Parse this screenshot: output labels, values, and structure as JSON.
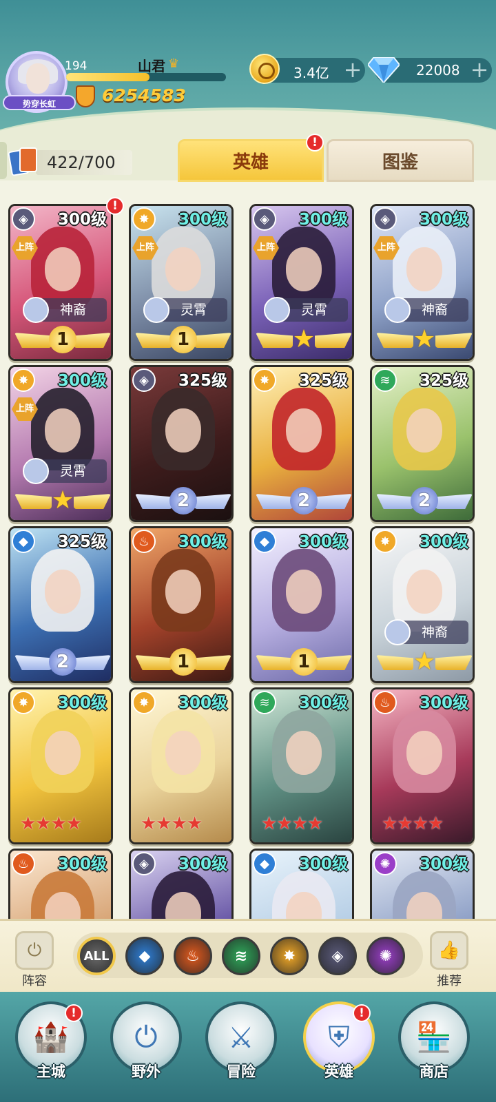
{
  "player": {
    "level": "194",
    "name": "山君",
    "title_badge": "势穿长虹",
    "power": "6254583",
    "xp_progress": 0.52
  },
  "resources": {
    "gold": "3.4亿",
    "diamonds": "22008",
    "plus": "+"
  },
  "collection": {
    "count": "422/700"
  },
  "tabs": {
    "heroes": "英雄",
    "gallery": "图鉴",
    "alert": "!"
  },
  "cards": [
    {
      "level": "300级",
      "level_color": "white",
      "faction": "dark",
      "deployed": "上阵",
      "label": "神裔",
      "rank": "1",
      "wing": "gold",
      "alert": "!"
    },
    {
      "level": "300级",
      "level_color": "cyan",
      "faction": "light",
      "deployed": "上阵",
      "label": "灵霄",
      "rank": "1",
      "wing": "gold"
    },
    {
      "level": "300级",
      "level_color": "cyan",
      "faction": "dark",
      "deployed": "上阵",
      "label": "灵霄",
      "rank": "★",
      "wing": "gold"
    },
    {
      "level": "300级",
      "level_color": "cyan",
      "faction": "dark",
      "deployed": "上阵",
      "label": "神裔",
      "rank": "★",
      "wing": "gold"
    },
    {
      "level": "300级",
      "level_color": "cyan",
      "faction": "light",
      "deployed": "上阵",
      "label": "灵霄",
      "rank": "★",
      "wing": "gold"
    },
    {
      "level": "325级",
      "level_color": "white",
      "faction": "dark",
      "rank": "2",
      "wing": "blue"
    },
    {
      "level": "325级",
      "level_color": "white",
      "faction": "light",
      "rank": "2",
      "wing": "blue"
    },
    {
      "level": "325级",
      "level_color": "white",
      "faction": "nature",
      "rank": "2",
      "wing": "blue"
    },
    {
      "level": "325级",
      "level_color": "white",
      "faction": "water",
      "rank": "2",
      "wing": "blue"
    },
    {
      "level": "300级",
      "level_color": "cyan",
      "faction": "fire",
      "rank": "1",
      "wing": "gold"
    },
    {
      "level": "300级",
      "level_color": "cyan",
      "faction": "water",
      "rank": "1",
      "wing": "gold"
    },
    {
      "level": "300级",
      "level_color": "cyan",
      "faction": "light",
      "label": "神裔",
      "rank": "★",
      "wing": "gold"
    },
    {
      "level": "300级",
      "level_color": "cyan",
      "faction": "light",
      "stars": "★★★★"
    },
    {
      "level": "300级",
      "level_color": "cyan",
      "faction": "light",
      "stars": "★★★★"
    },
    {
      "level": "300级",
      "level_color": "cyan",
      "faction": "nature",
      "stars": "★★★★"
    },
    {
      "level": "300级",
      "level_color": "cyan",
      "faction": "fire",
      "stars": "★★★★"
    },
    {
      "level": "300级",
      "level_color": "cyan",
      "faction": "fire"
    },
    {
      "level": "300级",
      "level_color": "cyan",
      "faction": "dark"
    },
    {
      "level": "300级",
      "level_color": "cyan",
      "faction": "water"
    },
    {
      "level": "300级",
      "level_color": "cyan",
      "faction": "arcane"
    }
  ],
  "filters": {
    "lineup_label": "阵容",
    "recommend_label": "推荐",
    "all_label": "ALL",
    "factions": [
      "water",
      "fire",
      "nature",
      "light",
      "dark",
      "arcane"
    ]
  },
  "nav": [
    {
      "label": "主城",
      "icon": "castle-icon",
      "alert": "!"
    },
    {
      "label": "野外",
      "icon": "portal-icon"
    },
    {
      "label": "冒险",
      "icon": "sword-icon"
    },
    {
      "label": "英雄",
      "icon": "helmet-icon",
      "alert": "!",
      "active": true
    },
    {
      "label": "商店",
      "icon": "shop-icon"
    }
  ],
  "colors": {
    "header_teal": "#3f8f96",
    "tab_gold": "#f5c63b",
    "alert_red": "#e52b2b",
    "level_cyan": "#6ff0e6",
    "faction_water": "#2f7fd6",
    "faction_fire": "#e05a1e",
    "faction_nature": "#2fa85a",
    "faction_light": "#f0a828",
    "faction_dark": "#5a5a7a",
    "faction_arcane": "#9a3fc8"
  }
}
